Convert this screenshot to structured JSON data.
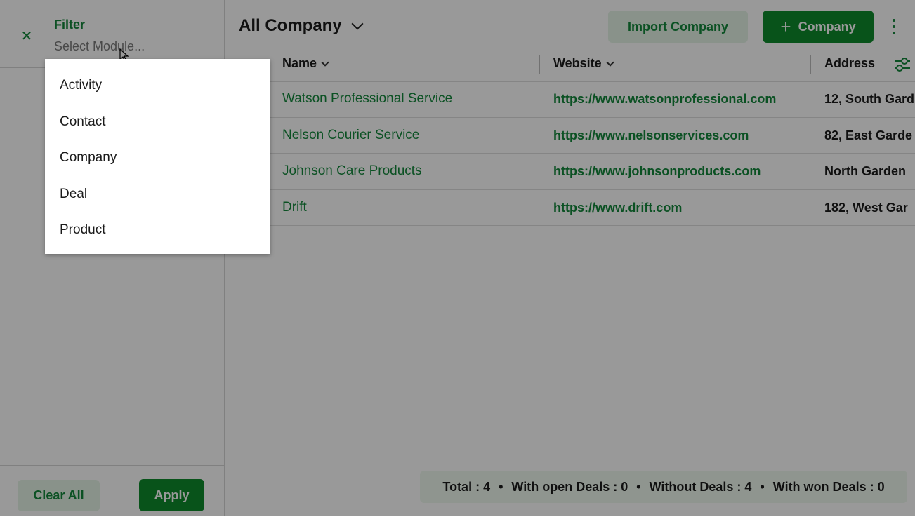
{
  "filter": {
    "close_icon": "close-icon",
    "title": "Filter",
    "module_placeholder": "Select Module...",
    "clear_label": "Clear All",
    "apply_label": "Apply"
  },
  "header": {
    "view_title": "All Company",
    "import_label": "Import Company",
    "add_label": "Company",
    "add_icon": "plus-icon",
    "more_icon": "more-vert-icon"
  },
  "table": {
    "columns": [
      "Name",
      "Website",
      "Address"
    ],
    "rows": [
      {
        "name": "Watson Professional Service",
        "website": "https://www.watsonprofessional.com",
        "address": "12, South Gard"
      },
      {
        "name": "Nelson Courier Service",
        "website": "https://www.nelsonservices.com",
        "address": "82, East Garde"
      },
      {
        "name": "Johnson Care Products",
        "website": "https://www.johnsonproducts.com",
        "address": "North Garden"
      },
      {
        "name": "Drift",
        "website": "https://www.drift.com",
        "address": "182, West Gar"
      }
    ]
  },
  "summary": {
    "total": "Total : 4",
    "open_deals": "With open Deals : 0",
    "without_deals": "Without Deals : 4",
    "won_deals": "With won Deals : 0",
    "separator": "•"
  },
  "dropdown": {
    "items": [
      "Activity",
      "Contact",
      "Company",
      "Deal",
      "Product"
    ]
  },
  "colors": {
    "brand_green": "#0e8a2c",
    "link_green": "#13873b",
    "light_green": "#e4f4e6"
  }
}
